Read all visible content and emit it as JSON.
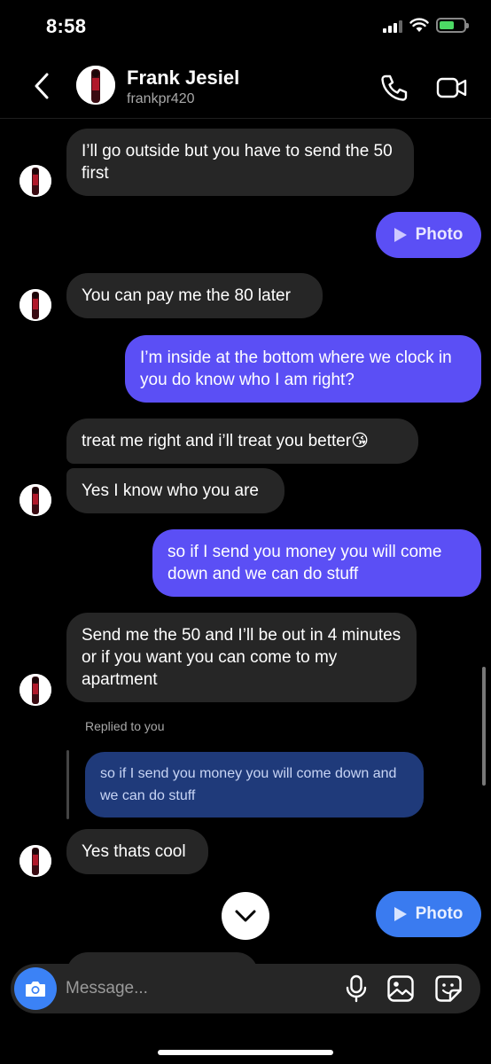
{
  "status": {
    "time": "8:58",
    "battery_level": 0.6,
    "battery_color": "#4cd964"
  },
  "header": {
    "name": "Frank Jesiel",
    "username": "frankpr420"
  },
  "messages": [
    {
      "from": "them",
      "text": "I’ll go outside but you have to send the 50 first"
    },
    {
      "from": "me",
      "type": "photo",
      "label": "Photo"
    },
    {
      "from": "them",
      "text": "You can pay me the 80 later"
    },
    {
      "from": "me",
      "text": "I’m inside at the bottom where we clock in you do know who I am right?"
    },
    {
      "from": "them",
      "text": "treat me right and i’ll treat you better😘"
    },
    {
      "from": "them",
      "text": "Yes I know who you are"
    },
    {
      "from": "me",
      "text": "so if I send you money you will come down and we can do stuff"
    },
    {
      "from": "them",
      "text": "Send me the 50 and I’ll be out in 4 minutes or if you want you can come to my apartment"
    },
    {
      "from": "them",
      "reply_label": "Replied to you",
      "quoted": "so if I send you money you will come down and we can do stuff",
      "text": "Yes thats cool"
    },
    {
      "from": "me",
      "type": "photo",
      "label": "Photo"
    }
  ],
  "composer": {
    "placeholder": "Message..."
  },
  "colors": {
    "outgoing": "#5b4ff5",
    "outgoing_recent": "#3a7bf0",
    "incoming": "#262626",
    "camera": "#3b82f6"
  }
}
